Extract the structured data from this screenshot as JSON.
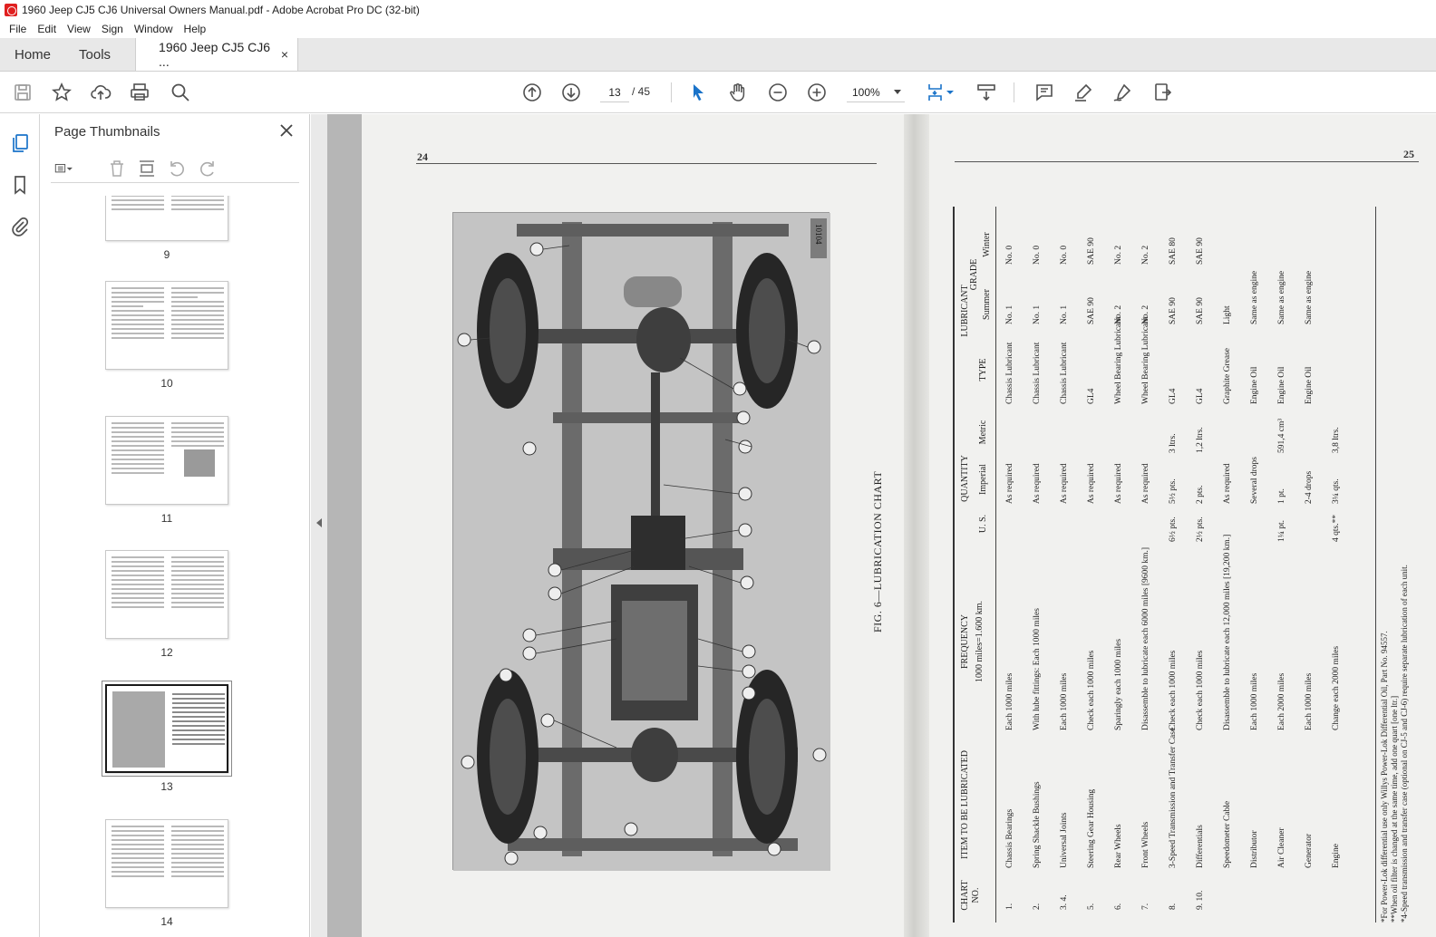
{
  "window": {
    "title": "1960 Jeep CJ5 CJ6 Universal Owners Manual.pdf - Adobe Acrobat Pro DC (32-bit)"
  },
  "menu": {
    "items": [
      "File",
      "Edit",
      "View",
      "Sign",
      "Window",
      "Help"
    ]
  },
  "tabs": {
    "home": "Home",
    "tools": "Tools",
    "document": "1960 Jeep CJ5 CJ6 ...",
    "close": "×"
  },
  "toolbar": {
    "current_page": "13",
    "page_separator": "/  45",
    "zoom": "100%"
  },
  "thumbnail_panel": {
    "title": "Page Thumbnails",
    "pages": [
      {
        "label": "9"
      },
      {
        "label": "10"
      },
      {
        "label": "11"
      },
      {
        "label": "12"
      },
      {
        "label": "13",
        "selected": true
      },
      {
        "label": "14"
      }
    ]
  },
  "document": {
    "left_page_number": "24",
    "right_page_number": "25",
    "figure_caption": "FIG. 6—LUBRICATION CHART",
    "figure_id": "10104",
    "table": {
      "group_headers": {
        "quantity": "QUANTITY",
        "lubricant": "LUBRICANT",
        "grade": "GRADE"
      },
      "headers": {
        "chart_no": "CHART NO.",
        "item": "ITEM TO BE LUBRICATED",
        "frequency": "FREQUENCY",
        "frequency_note": "1000 miles=1.600 km.",
        "us": "U. S.",
        "imperial": "Imperial",
        "metric": "Metric",
        "type": "TYPE",
        "summer": "Summer",
        "winter": "Winter"
      },
      "rows": [
        {
          "no": "1.",
          "item": "Chassis Bearings",
          "freq": "Each 1000 miles",
          "us": "",
          "imp": "As required",
          "metric": "",
          "type": "Chassis Lubricant",
          "summer": "No. 1",
          "winter": "No. 0"
        },
        {
          "no": "2.",
          "item": "Spring Shackle Bushings",
          "freq": "With lube fittings: Each 1000 miles",
          "us": "",
          "imp": "As required",
          "metric": "",
          "type": "Chassis Lubricant",
          "summer": "No. 1",
          "winter": "No. 0"
        },
        {
          "no": "3. 4.",
          "item": "Universal Joints",
          "freq": "Each 1000 miles",
          "us": "",
          "imp": "As required",
          "metric": "",
          "type": "Chassis Lubricant",
          "summer": "No. 1",
          "winter": "No. 0"
        },
        {
          "no": "5.",
          "item": "Steering Gear Housing",
          "freq": "Check each 1000 miles",
          "us": "",
          "imp": "As required",
          "metric": "",
          "type": "GL4",
          "summer": "SAE 90",
          "winter": "SAE 90"
        },
        {
          "no": "6.",
          "item": "Rear Wheels",
          "freq": "Sparingly each 1000 miles",
          "us": "",
          "imp": "As required",
          "metric": "",
          "type": "Wheel Bearing Lubricant",
          "summer": "No. 2",
          "winter": "No. 2"
        },
        {
          "no": "7.",
          "item": "Front Wheels",
          "freq": "Disassemble to lubricate each 6000 miles [9600 km.]",
          "us": "",
          "imp": "As required",
          "metric": "",
          "type": "Wheel Bearing Lubricant",
          "summer": "No. 2",
          "winter": "No. 2"
        },
        {
          "no": "8.",
          "item": "3-Speed Transmission and Transfer Case",
          "freq": "Check each 1000 miles",
          "us": "6½ pts.",
          "imp": "5½ pts.",
          "metric": "3 ltrs.",
          "type": "GL4",
          "summer": "SAE 90",
          "winter": "SAE 80"
        },
        {
          "no": "9. 10.",
          "item": "Differentials",
          "freq": "Check each 1000 miles",
          "us": "2½ pts.",
          "imp": "2 pts.",
          "metric": "1,2 ltrs.",
          "type": "GL4",
          "summer": "SAE 90",
          "winter": "SAE 90"
        },
        {
          "no": "",
          "item": "Speedometer Cable",
          "freq": "Disassemble to lubricate each 12,000 miles [19,200 km.]",
          "us": "",
          "imp": "As required",
          "metric": "",
          "type": "Graphite Grease",
          "summer": "Light",
          "winter": ""
        },
        {
          "no": "",
          "item": "Distributor",
          "freq": "Each 1000 miles",
          "us": "",
          "imp": "Several drops",
          "metric": "",
          "type": "Engine Oil",
          "summer": "Same as engine",
          "winter": ""
        },
        {
          "no": "",
          "item": "Air Cleaner",
          "freq": "Each 2000 miles",
          "us": "1¼ pt.",
          "imp": "1 pt.",
          "metric": "591,4 cm³",
          "type": "Engine Oil",
          "summer": "Same as engine",
          "winter": ""
        },
        {
          "no": "",
          "item": "Generator",
          "freq": "Each 1000 miles",
          "us": "",
          "imp": "2-4 drops",
          "metric": "",
          "type": "Engine Oil",
          "summer": "Same as engine",
          "winter": ""
        },
        {
          "no": "",
          "item": "Engine",
          "freq": "Change each 2000 miles",
          "us": "4 qts.**",
          "imp": "3¼ qts.",
          "metric": "3,8 ltrs.",
          "type": "",
          "summer": "",
          "winter": ""
        }
      ],
      "footnotes": [
        "*For Power-Lok differential use only Willys Power-Lok Differential Oil, Part No. 94557.",
        "**When oil filter is changed at the same time, add one quart [one ltr.]",
        "*4-Speed transmission and transfer case (optional on CJ-5 and CJ-6) require separate lubrication of each unit."
      ]
    }
  }
}
